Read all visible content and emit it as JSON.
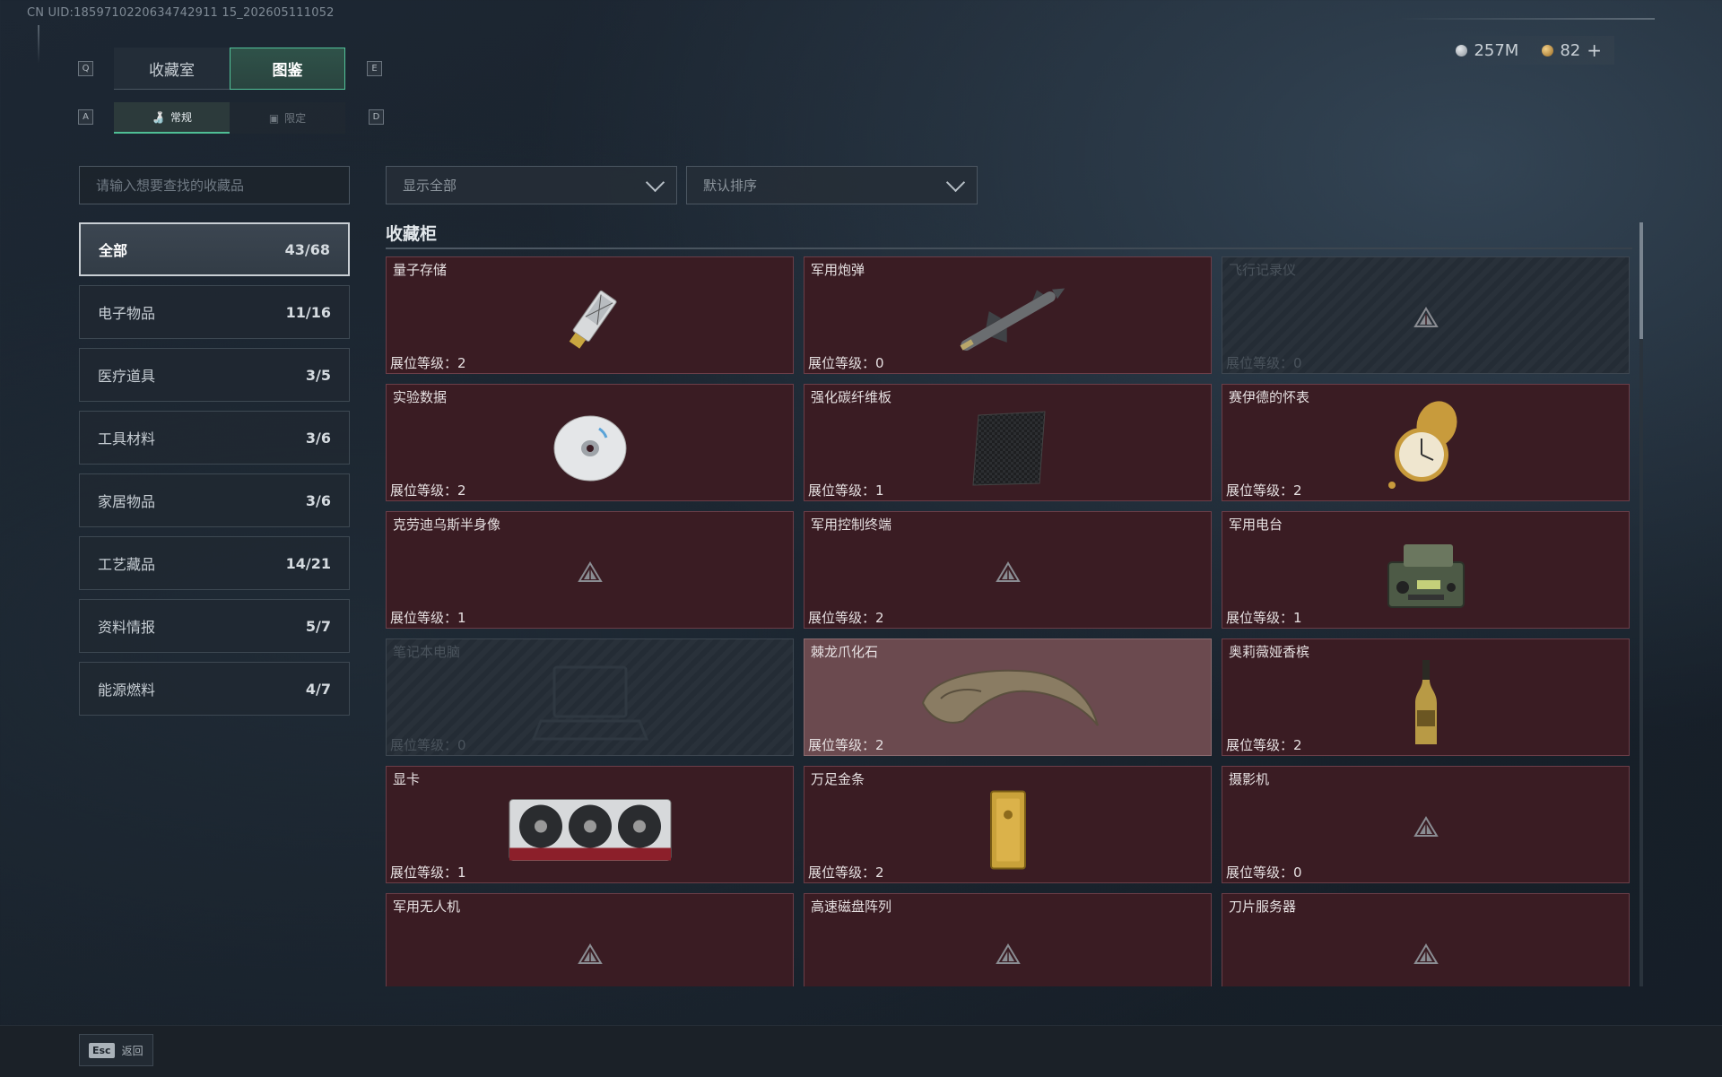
{
  "header": {
    "uid": "CN UID:1859710220634742911 15_202605111052",
    "currency": {
      "silver": "257M",
      "gold": "82",
      "add": "+"
    }
  },
  "tabs": {
    "main": [
      {
        "label": "收藏室",
        "key": "Q"
      },
      {
        "label": "图鉴",
        "key": "E"
      }
    ],
    "sub": [
      {
        "label": "常规",
        "key": "A"
      },
      {
        "label": "限定",
        "key": "D"
      }
    ]
  },
  "search": {
    "placeholder": "请输入想要查找的收藏品"
  },
  "filters": {
    "show": "显示全部",
    "sort": "默认排序"
  },
  "categories": [
    {
      "label": "全部",
      "count": "43/68"
    },
    {
      "label": "电子物品",
      "count": "11/16"
    },
    {
      "label": "医疗道具",
      "count": "3/5"
    },
    {
      "label": "工具材料",
      "count": "3/6"
    },
    {
      "label": "家居物品",
      "count": "3/6"
    },
    {
      "label": "工艺藏品",
      "count": "14/21"
    },
    {
      "label": "资料情报",
      "count": "5/7"
    },
    {
      "label": "能源燃料",
      "count": "4/7"
    }
  ],
  "section": {
    "title": "收藏柜"
  },
  "items": [
    {
      "name": "量子存储",
      "level": "展位等级：2",
      "icon": "usb-drive-icon",
      "state": "owned"
    },
    {
      "name": "军用炮弹",
      "level": "展位等级：0",
      "icon": "missile-icon",
      "state": "owned"
    },
    {
      "name": "飞行记录仪",
      "level": "展位等级：0",
      "icon": "placeholder-icon",
      "state": "locked"
    },
    {
      "name": "实验数据",
      "level": "展位等级：2",
      "icon": "disc-icon",
      "state": "owned"
    },
    {
      "name": "强化碳纤维板",
      "level": "展位等级：1",
      "icon": "carbon-plate-icon",
      "state": "owned"
    },
    {
      "name": "赛伊德的怀表",
      "level": "展位等级：2",
      "icon": "pocket-watch-icon",
      "state": "owned"
    },
    {
      "name": "克劳迪乌斯半身像",
      "level": "展位等级：1",
      "icon": "placeholder-icon",
      "state": "owned"
    },
    {
      "name": "军用控制终端",
      "level": "展位等级：2",
      "icon": "placeholder-icon",
      "state": "owned"
    },
    {
      "name": "军用电台",
      "level": "展位等级：1",
      "icon": "radio-icon",
      "state": "owned"
    },
    {
      "name": "笔记本电脑",
      "level": "展位等级：0",
      "icon": "laptop-icon",
      "state": "locked"
    },
    {
      "name": "棘龙爪化石",
      "level": "展位等级：2",
      "icon": "claw-fossil-icon",
      "state": "highlight"
    },
    {
      "name": "奥莉薇娅香槟",
      "level": "展位等级：2",
      "icon": "champagne-icon",
      "state": "owned"
    },
    {
      "name": "显卡",
      "level": "展位等级：1",
      "icon": "graphics-card-icon",
      "state": "owned"
    },
    {
      "name": "万足金条",
      "level": "展位等级：2",
      "icon": "gold-bar-icon",
      "state": "owned"
    },
    {
      "name": "摄影机",
      "level": "展位等级：0",
      "icon": "placeholder-icon",
      "state": "owned"
    },
    {
      "name": "军用无人机",
      "level": "",
      "icon": "placeholder-icon",
      "state": "owned"
    },
    {
      "name": "高速磁盘阵列",
      "level": "",
      "icon": "placeholder-icon",
      "state": "owned"
    },
    {
      "name": "刀片服务器",
      "level": "",
      "icon": "placeholder-icon",
      "state": "owned"
    }
  ],
  "footer": {
    "key": "Esc",
    "label": "返回"
  },
  "colors": {
    "accent": "#52c49a",
    "card": "#3a1c23",
    "cardBorder": "#6b3e48",
    "highlightCard": "#6b4a4f"
  }
}
